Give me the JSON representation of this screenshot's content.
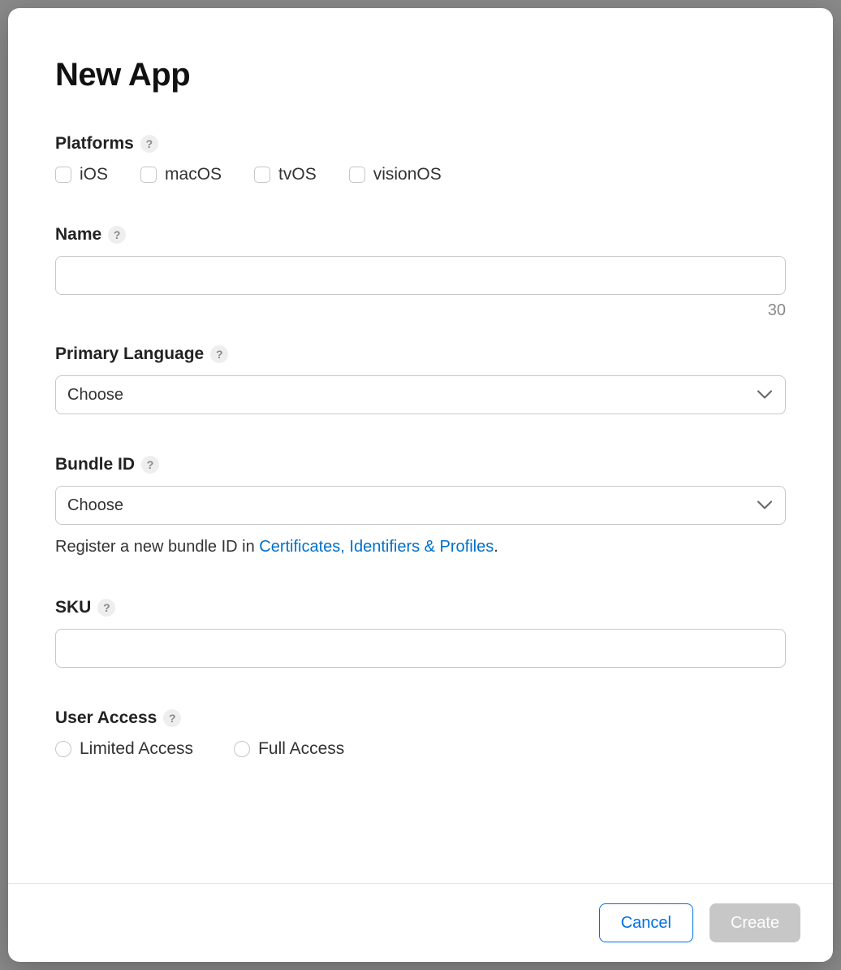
{
  "dialog": {
    "title": "New App",
    "help_icon": "?",
    "platforms": {
      "label": "Platforms",
      "options": {
        "ios": "iOS",
        "macos": "macOS",
        "tvos": "tvOS",
        "visionos": "visionOS"
      }
    },
    "name": {
      "label": "Name",
      "value": "",
      "counter": "30"
    },
    "primary_language": {
      "label": "Primary Language",
      "selected": "Choose"
    },
    "bundle_id": {
      "label": "Bundle ID",
      "selected": "Choose",
      "hint_prefix": "Register a new bundle ID in ",
      "hint_link": "Certificates, Identifiers & Profiles",
      "hint_suffix": "."
    },
    "sku": {
      "label": "SKU",
      "value": ""
    },
    "user_access": {
      "label": "User Access",
      "options": {
        "limited": "Limited Access",
        "full": "Full Access"
      }
    },
    "footer": {
      "cancel": "Cancel",
      "create": "Create"
    }
  }
}
